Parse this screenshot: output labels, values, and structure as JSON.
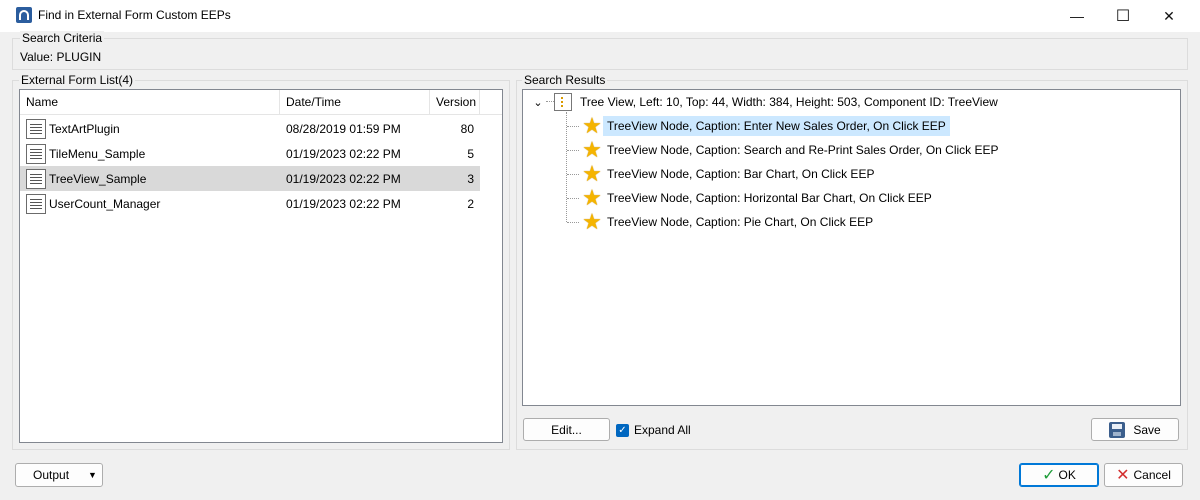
{
  "window": {
    "title": "Find in External Form Custom EEPs",
    "minimize_glyph": "—",
    "maximize_glyph": "☐",
    "close_glyph": "✕"
  },
  "search_criteria": {
    "group_label": "Search Criteria",
    "value_text": "Value: PLUGIN"
  },
  "form_list": {
    "group_label": "External Form List(4)",
    "columns": [
      "Name",
      "Date/Time",
      "Version"
    ],
    "rows": [
      {
        "name": "TextArtPlugin",
        "datetime": "08/28/2019 01:59 PM",
        "version": "80"
      },
      {
        "name": "TileMenu_Sample",
        "datetime": "01/19/2023 02:22 PM",
        "version": "5"
      },
      {
        "name": "TreeView_Sample",
        "datetime": "01/19/2023 02:22 PM",
        "version": "3"
      },
      {
        "name": "UserCount_Manager",
        "datetime": "01/19/2023 02:22 PM",
        "version": "2"
      }
    ],
    "selected_row": 2
  },
  "search_results": {
    "group_label": "Search Results",
    "root": "Tree View, Left: 10, Top: 44, Width: 384, Height: 503, Component ID: TreeView",
    "children": [
      "TreeView Node, Caption: Enter New Sales Order, On Click EEP",
      "TreeView Node, Caption: Search and Re-Print Sales Order, On Click EEP",
      "TreeView Node, Caption: Bar Chart, On Click EEP",
      "TreeView Node, Caption: Horizontal Bar Chart, On Click EEP",
      "TreeView Node, Caption: Pie Chart, On Click EEP"
    ],
    "selected_child": 0,
    "edit_label": "Edit...",
    "expand_all_label": "Expand All",
    "expand_all_checked": true,
    "save_label": "Save"
  },
  "footer": {
    "output_label": "Output",
    "ok_label": "OK",
    "cancel_label": "Cancel"
  },
  "colors": {
    "accent": "#0078d7",
    "selection_tree": "#cce8ff",
    "selection_list": "#d9d9d9",
    "ok_check": "#1f9d3a",
    "cancel_x": "#d32f2f"
  }
}
